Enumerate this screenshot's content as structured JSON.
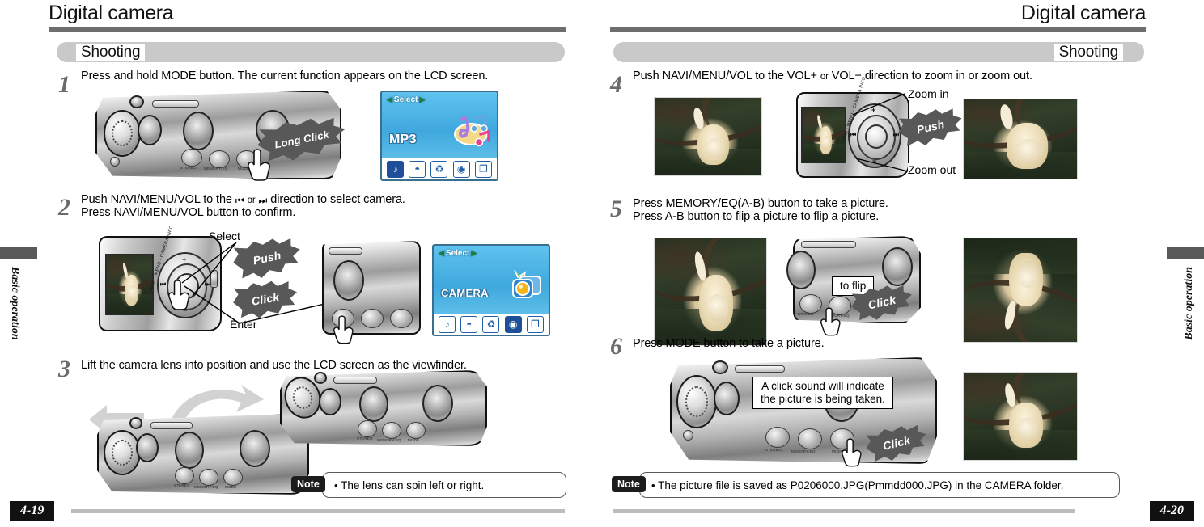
{
  "left_page": {
    "header_title": "Digital camera",
    "section_label": "Shooting",
    "side_tab": "Basic operation",
    "page_number": "4-19",
    "steps": [
      {
        "number": "1",
        "line1": "Press and hold MODE button. The current function appears on the LCD screen.",
        "callout": "Long Click",
        "lcd": {
          "select": "Select",
          "mode": "MP3",
          "icons": [
            "music-note-icon",
            "radio-icon",
            "microphone-icon",
            "camera-icon",
            "photo-album-icon"
          ],
          "active_icon_index": 0
        }
      },
      {
        "number": "2",
        "line1_a": "Push NAVI/MENU/VOL to the",
        "line1_icon_prev": "prev-track-icon",
        "line1_or": "or",
        "line1_icon_next": "next-track-icon",
        "line1_b": "direction to select camera.",
        "line2": "Press NAVI/MENU/VOL button to confirm.",
        "label_select": "Select",
        "label_enter": "Enter",
        "callout_push": "Push",
        "callout_click": "Click",
        "dial_legend": "NAVI - MENU - CAMERA INFO",
        "lcd": {
          "select": "Select",
          "mode": "CAMERA",
          "icons": [
            "music-note-icon",
            "radio-icon",
            "microphone-icon",
            "camera-icon",
            "photo-album-icon"
          ],
          "active_icon_index": 3
        }
      },
      {
        "number": "3",
        "line1": "Lift the camera lens into position and use the LCD screen as the viewfinder.",
        "note_badge": "Note",
        "note_text": "The lens can spin left or right."
      }
    ]
  },
  "right_page": {
    "header_title": "Digital camera",
    "section_label": "Shooting",
    "side_tab": "Basic operation",
    "page_number": "4-20",
    "steps": [
      {
        "number": "4",
        "line1_a": "Push NAVI/MENU/VOL to the VOL+",
        "line1_or": "or",
        "line1_b": "VOL−",
        "line1_c": "direction to zoom in or zoom out.",
        "label_zoom_in": "Zoom in",
        "label_zoom_out": "Zoom out",
        "callout_push": "Push",
        "dial_legend": "NAVI - MENU - CAMERA INFO"
      },
      {
        "number": "5",
        "line1": "Press MEMORY/EQ(A-B) button to take a picture.",
        "line2": "Press A-B button to flip a picture to flip a picture.",
        "label_to_flip": "to flip",
        "callout_click": "Click"
      },
      {
        "number": "6",
        "line1": "Press MODE button to  take a picture.",
        "callout_box_line1": "A click sound will indicate",
        "callout_box_line2": "the picture is being taken.",
        "callout_click": "Click",
        "note_badge": "Note",
        "note_text": "The picture file is saved as P0206000.JPG(Pmmdd000.JPG) in the CAMERA folder."
      }
    ]
  },
  "device_labels": {
    "btn_stereo": "STEREO",
    "btn_memory": "MEMORY/EQ",
    "btn_mode": "MODE"
  },
  "colors": {
    "rule": "#6e6e6e",
    "band": "#c9c9c9",
    "lcd_blue": "#3fa8dd",
    "note_border": "#5a5a5a",
    "page_badge": "#111111",
    "burst": "#585858"
  }
}
